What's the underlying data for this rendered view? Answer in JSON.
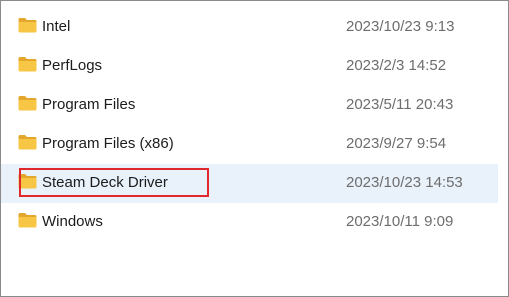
{
  "file_list": {
    "items": [
      {
        "name": "Intel",
        "date_modified": "2023/10/23 9:13",
        "icon": "folder-icon",
        "selected": false
      },
      {
        "name": "PerfLogs",
        "date_modified": "2023/2/3 14:52",
        "icon": "folder-icon",
        "selected": false
      },
      {
        "name": "Program Files",
        "date_modified": "2023/5/11 20:43",
        "icon": "folder-icon",
        "selected": false
      },
      {
        "name": "Program Files (x86)",
        "date_modified": "2023/9/27 9:54",
        "icon": "folder-icon",
        "selected": false
      },
      {
        "name": "Steam Deck Driver",
        "date_modified": "2023/10/23 14:53",
        "icon": "folder-icon",
        "selected": true
      },
      {
        "name": "Windows",
        "date_modified": "2023/10/11 9:09",
        "icon": "folder-icon",
        "selected": false
      }
    ]
  },
  "colors": {
    "folder": "#f7c644",
    "folder_back": "#e3a72e",
    "selection_background": "#e9f1fb",
    "highlight_box": "#e0272b"
  }
}
